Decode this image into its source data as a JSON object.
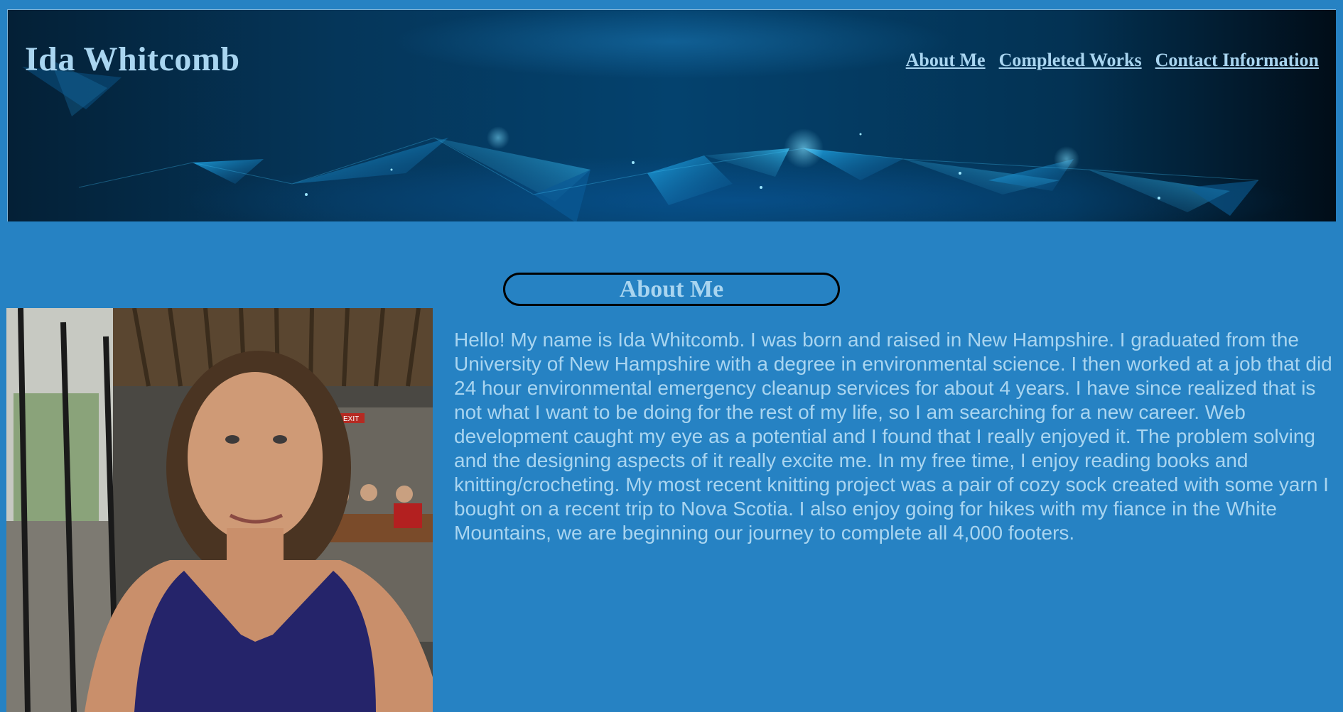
{
  "header": {
    "site_title": "Ida Whitcomb",
    "nav": [
      "About Me",
      "Completed Works",
      "Contact Information"
    ]
  },
  "about": {
    "heading": "About Me",
    "bio": "Hello! My name is Ida Whitcomb. I was born and raised in New Hampshire. I graduated from the University of New Hampshire with a degree in environmental science. I then worked at a job that did 24 hour environmental emergency cleanup services for about 4 years. I have since realized that is not what I want to be doing for the rest of my life, so I am searching for a new career. Web development caught my eye as a potential and I found that I really enjoyed it. The problem solving and the designing aspects of it really excite me. In my free time, I enjoy reading books and knitting/crocheting. My most recent knitting project was a pair of cozy sock created with some yarn I bought on a recent trip to Nova Scotia. I also enjoy going for hikes with my fiance in the White Mountains, we are beginning our journey to complete all 4,000 footers.",
    "photo_sign": "EXIT"
  },
  "colors": {
    "page_background": "#2682c3",
    "text_accent": "#a9d5f0",
    "heading_border": "#000000"
  },
  "icons": {
    "hero": "abstract-blue-network-banner",
    "photo": "portrait-photo"
  }
}
